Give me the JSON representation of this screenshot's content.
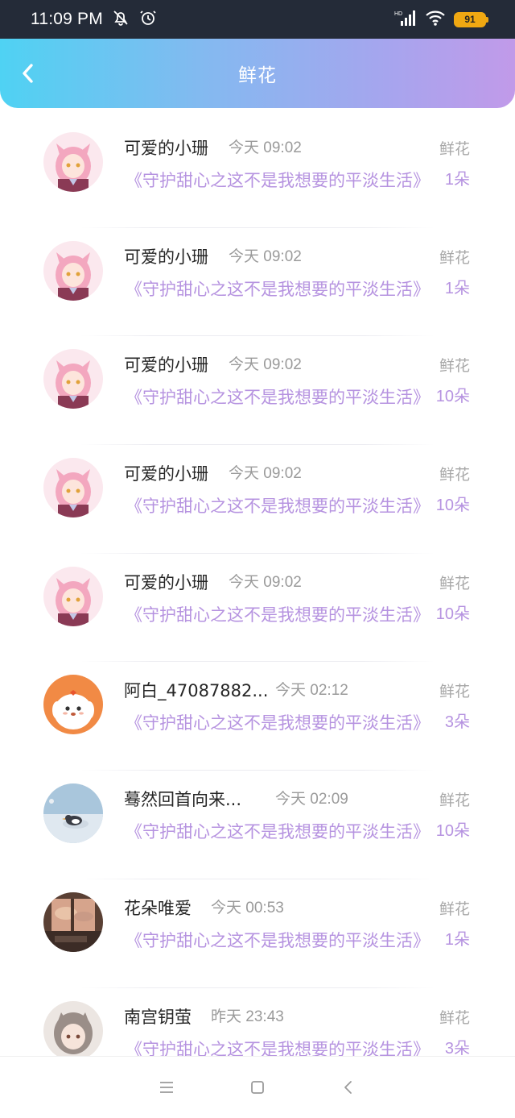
{
  "status_bar": {
    "time": "11:09 PM",
    "battery": "91",
    "network_label": "HD",
    "icons": [
      "mute-bell-icon",
      "alarm-icon",
      "signal-icon",
      "wifi-icon",
      "battery-icon"
    ]
  },
  "header": {
    "title": "鲜花",
    "back_icon": "chevron-left-icon",
    "gradient": [
      "#4fd2f3",
      "#c19ae9"
    ]
  },
  "colors": {
    "accent": "#b693e0",
    "muted": "#9a9a9a"
  },
  "items": [
    {
      "name": "可爱的小珊",
      "time": "今天 09:02",
      "book": "《守护甜心之这不是我想要的平淡生活》",
      "gift": "鲜花",
      "count": "1朵",
      "avatar": "pink-anime-girl"
    },
    {
      "name": "可爱的小珊",
      "time": "今天 09:02",
      "book": "《守护甜心之这不是我想要的平淡生活》",
      "gift": "鲜花",
      "count": "1朵",
      "avatar": "pink-anime-girl"
    },
    {
      "name": "可爱的小珊",
      "time": "今天 09:02",
      "book": "《守护甜心之这不是我想要的平淡生活》",
      "gift": "鲜花",
      "count": "10朵",
      "avatar": "pink-anime-girl"
    },
    {
      "name": "可爱的小珊",
      "time": "今天 09:02",
      "book": "《守护甜心之这不是我想要的平淡生活》",
      "gift": "鲜花",
      "count": "10朵",
      "avatar": "pink-anime-girl"
    },
    {
      "name": "可爱的小珊",
      "time": "今天 09:02",
      "book": "《守护甜心之这不是我想要的平淡生活》",
      "gift": "鲜花",
      "count": "10朵",
      "avatar": "pink-anime-girl"
    },
    {
      "name": "阿白_47087882...",
      "time": "今天 02:12",
      "book": "《守护甜心之这不是我想要的平淡生活》",
      "gift": "鲜花",
      "count": "3朵",
      "avatar": "white-dog-orange"
    },
    {
      "name": "蓦然回首向来...",
      "time": "今天 02:09",
      "book": "《守护甜心之这不是我想要的平淡生活》",
      "gift": "鲜花",
      "count": "10朵",
      "avatar": "penguin-ice"
    },
    {
      "name": "花朵唯爱",
      "time": "今天 00:53",
      "book": "《守护甜心之这不是我想要的平淡生活》",
      "gift": "鲜花",
      "count": "1朵",
      "avatar": "sunset-room"
    },
    {
      "name": "南宫钥萤",
      "time": "昨天 23:43",
      "book": "《守护甜心之这不是我想要的平淡生活》",
      "gift": "鲜花",
      "count": "3朵",
      "avatar": "gray-hair-girl"
    }
  ],
  "nav_bar": {
    "icons": [
      "menu-icon",
      "home-icon",
      "back-icon"
    ]
  }
}
